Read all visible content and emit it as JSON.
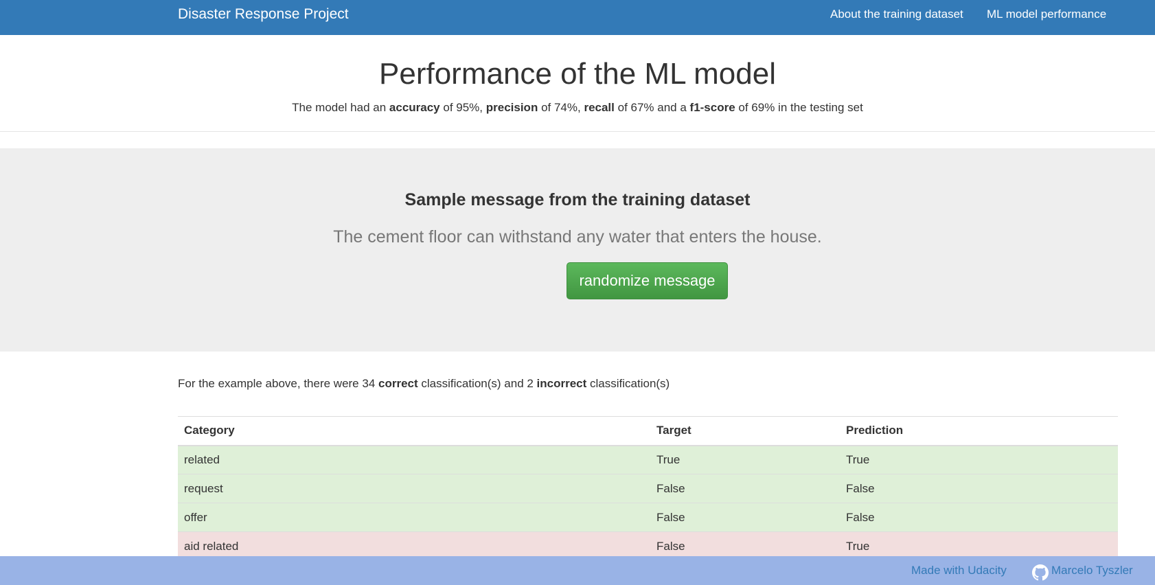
{
  "navbar": {
    "brand": "Disaster Response Project",
    "links": [
      "About the training dataset",
      "ML model performance"
    ]
  },
  "performance": {
    "title": "Performance of the ML model",
    "text_1": "The model had an ",
    "accuracy_label": "accuracy",
    "text_2": " of 95%, ",
    "precision_label": "precision",
    "text_3": " of 74%, ",
    "recall_label": "recall",
    "text_4": " of 67% and a ",
    "f1_label": "f1-score",
    "text_5": " of 69% in the testing set"
  },
  "sample": {
    "heading": "Sample message from the training dataset",
    "message": "The cement floor can withstand any water that enters the house.",
    "button_label": "randomize message"
  },
  "summary": {
    "text_1": "For the example above, there were 34 ",
    "correct_label": "correct",
    "text_2": " classification(s) and 2 ",
    "incorrect_label": "incorrect",
    "text_3": " classification(s)"
  },
  "table": {
    "headers": [
      "Category",
      "Target",
      "Prediction"
    ],
    "rows": [
      {
        "category": "related",
        "target": "True",
        "prediction": "True",
        "status": "correct"
      },
      {
        "category": "request",
        "target": "False",
        "prediction": "False",
        "status": "correct"
      },
      {
        "category": "offer",
        "target": "False",
        "prediction": "False",
        "status": "correct"
      },
      {
        "category": "aid related",
        "target": "False",
        "prediction": "True",
        "status": "incorrect"
      }
    ]
  },
  "footer": {
    "udacity": "Made with Udacity",
    "author": "Marcelo Tyszler",
    "author_icon": "github-icon"
  },
  "colors": {
    "navbar": "#337ab7",
    "button": "#5cb85c",
    "correct_row": "#dff0d8",
    "incorrect_row": "#f2dede",
    "footer": "#99b3e6"
  }
}
